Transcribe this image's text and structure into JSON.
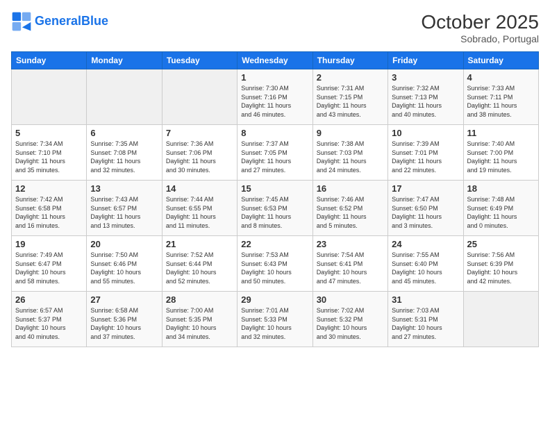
{
  "header": {
    "logo_line1": "General",
    "logo_line2": "Blue",
    "month": "October 2025",
    "location": "Sobrado, Portugal"
  },
  "days_of_week": [
    "Sunday",
    "Monday",
    "Tuesday",
    "Wednesday",
    "Thursday",
    "Friday",
    "Saturday"
  ],
  "weeks": [
    [
      {
        "day": "",
        "info": ""
      },
      {
        "day": "",
        "info": ""
      },
      {
        "day": "",
        "info": ""
      },
      {
        "day": "1",
        "info": "Sunrise: 7:30 AM\nSunset: 7:16 PM\nDaylight: 11 hours\nand 46 minutes."
      },
      {
        "day": "2",
        "info": "Sunrise: 7:31 AM\nSunset: 7:15 PM\nDaylight: 11 hours\nand 43 minutes."
      },
      {
        "day": "3",
        "info": "Sunrise: 7:32 AM\nSunset: 7:13 PM\nDaylight: 11 hours\nand 40 minutes."
      },
      {
        "day": "4",
        "info": "Sunrise: 7:33 AM\nSunset: 7:11 PM\nDaylight: 11 hours\nand 38 minutes."
      }
    ],
    [
      {
        "day": "5",
        "info": "Sunrise: 7:34 AM\nSunset: 7:10 PM\nDaylight: 11 hours\nand 35 minutes."
      },
      {
        "day": "6",
        "info": "Sunrise: 7:35 AM\nSunset: 7:08 PM\nDaylight: 11 hours\nand 32 minutes."
      },
      {
        "day": "7",
        "info": "Sunrise: 7:36 AM\nSunset: 7:06 PM\nDaylight: 11 hours\nand 30 minutes."
      },
      {
        "day": "8",
        "info": "Sunrise: 7:37 AM\nSunset: 7:05 PM\nDaylight: 11 hours\nand 27 minutes."
      },
      {
        "day": "9",
        "info": "Sunrise: 7:38 AM\nSunset: 7:03 PM\nDaylight: 11 hours\nand 24 minutes."
      },
      {
        "day": "10",
        "info": "Sunrise: 7:39 AM\nSunset: 7:01 PM\nDaylight: 11 hours\nand 22 minutes."
      },
      {
        "day": "11",
        "info": "Sunrise: 7:40 AM\nSunset: 7:00 PM\nDaylight: 11 hours\nand 19 minutes."
      }
    ],
    [
      {
        "day": "12",
        "info": "Sunrise: 7:42 AM\nSunset: 6:58 PM\nDaylight: 11 hours\nand 16 minutes."
      },
      {
        "day": "13",
        "info": "Sunrise: 7:43 AM\nSunset: 6:57 PM\nDaylight: 11 hours\nand 13 minutes."
      },
      {
        "day": "14",
        "info": "Sunrise: 7:44 AM\nSunset: 6:55 PM\nDaylight: 11 hours\nand 11 minutes."
      },
      {
        "day": "15",
        "info": "Sunrise: 7:45 AM\nSunset: 6:53 PM\nDaylight: 11 hours\nand 8 minutes."
      },
      {
        "day": "16",
        "info": "Sunrise: 7:46 AM\nSunset: 6:52 PM\nDaylight: 11 hours\nand 5 minutes."
      },
      {
        "day": "17",
        "info": "Sunrise: 7:47 AM\nSunset: 6:50 PM\nDaylight: 11 hours\nand 3 minutes."
      },
      {
        "day": "18",
        "info": "Sunrise: 7:48 AM\nSunset: 6:49 PM\nDaylight: 11 hours\nand 0 minutes."
      }
    ],
    [
      {
        "day": "19",
        "info": "Sunrise: 7:49 AM\nSunset: 6:47 PM\nDaylight: 10 hours\nand 58 minutes."
      },
      {
        "day": "20",
        "info": "Sunrise: 7:50 AM\nSunset: 6:46 PM\nDaylight: 10 hours\nand 55 minutes."
      },
      {
        "day": "21",
        "info": "Sunrise: 7:52 AM\nSunset: 6:44 PM\nDaylight: 10 hours\nand 52 minutes."
      },
      {
        "day": "22",
        "info": "Sunrise: 7:53 AM\nSunset: 6:43 PM\nDaylight: 10 hours\nand 50 minutes."
      },
      {
        "day": "23",
        "info": "Sunrise: 7:54 AM\nSunset: 6:41 PM\nDaylight: 10 hours\nand 47 minutes."
      },
      {
        "day": "24",
        "info": "Sunrise: 7:55 AM\nSunset: 6:40 PM\nDaylight: 10 hours\nand 45 minutes."
      },
      {
        "day": "25",
        "info": "Sunrise: 7:56 AM\nSunset: 6:39 PM\nDaylight: 10 hours\nand 42 minutes."
      }
    ],
    [
      {
        "day": "26",
        "info": "Sunrise: 6:57 AM\nSunset: 5:37 PM\nDaylight: 10 hours\nand 40 minutes."
      },
      {
        "day": "27",
        "info": "Sunrise: 6:58 AM\nSunset: 5:36 PM\nDaylight: 10 hours\nand 37 minutes."
      },
      {
        "day": "28",
        "info": "Sunrise: 7:00 AM\nSunset: 5:35 PM\nDaylight: 10 hours\nand 34 minutes."
      },
      {
        "day": "29",
        "info": "Sunrise: 7:01 AM\nSunset: 5:33 PM\nDaylight: 10 hours\nand 32 minutes."
      },
      {
        "day": "30",
        "info": "Sunrise: 7:02 AM\nSunset: 5:32 PM\nDaylight: 10 hours\nand 30 minutes."
      },
      {
        "day": "31",
        "info": "Sunrise: 7:03 AM\nSunset: 5:31 PM\nDaylight: 10 hours\nand 27 minutes."
      },
      {
        "day": "",
        "info": ""
      }
    ]
  ]
}
